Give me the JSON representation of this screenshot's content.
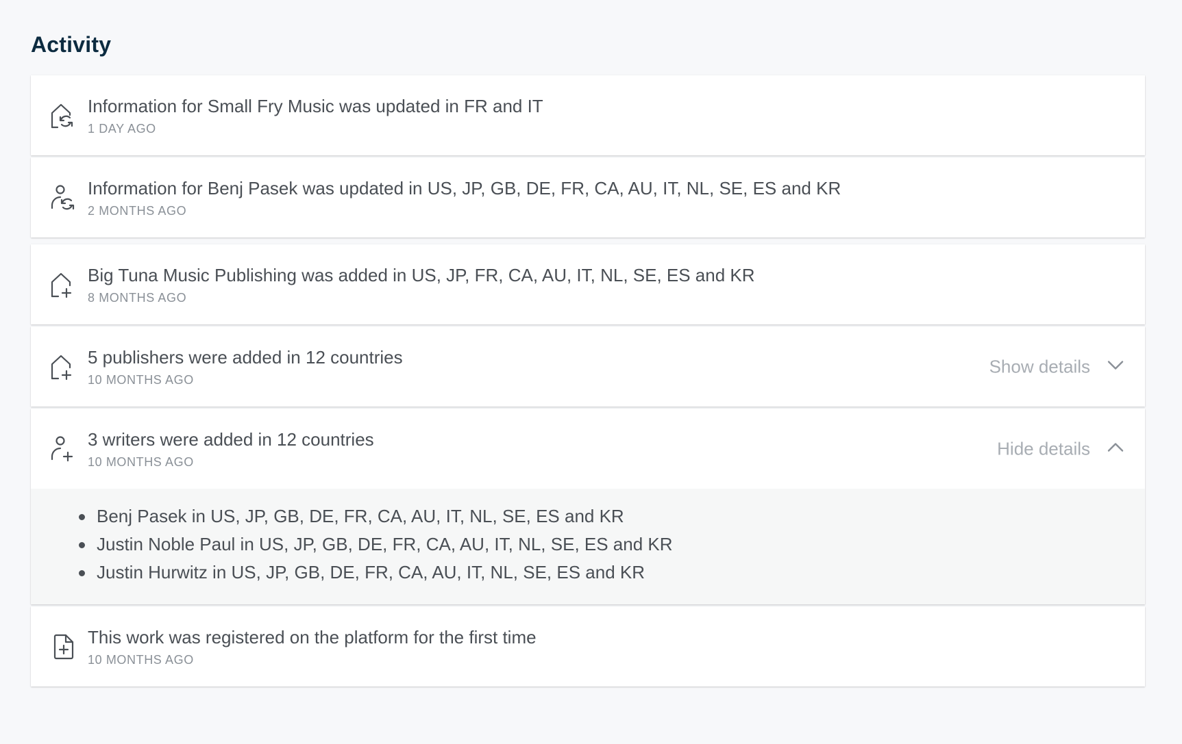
{
  "page": {
    "title": "Activity"
  },
  "activities": [
    {
      "icon": "publisher-update-icon",
      "message": "Information for Small Fry Music was updated in FR and IT",
      "time": "1 DAY AGO"
    },
    {
      "icon": "writer-update-icon",
      "message": "Information for Benj Pasek was updated in US, JP, GB, DE, FR, CA, AU, IT, NL, SE, ES and KR",
      "time": "2 MONTHS AGO"
    },
    {
      "icon": "publisher-add-icon",
      "message": "Big Tuna Music Publishing was added in US, JP, FR, CA, AU, IT, NL, SE, ES and KR",
      "time": "8 MONTHS AGO"
    },
    {
      "icon": "publisher-add-icon",
      "message": "5 publishers were added in 12 countries",
      "time": "10 MONTHS AGO",
      "toggle": "Show details"
    },
    {
      "icon": "writer-add-icon",
      "message": "3 writers were added in 12 countries",
      "time": "10 MONTHS AGO",
      "toggle": "Hide details",
      "details": [
        "Benj Pasek in US, JP, GB, DE, FR, CA, AU, IT, NL, SE, ES and KR",
        "Justin Noble Paul in US, JP, GB, DE, FR, CA, AU, IT, NL, SE, ES and KR",
        "Justin Hurwitz in US, JP, GB, DE, FR, CA, AU, IT, NL, SE, ES and KR"
      ]
    },
    {
      "icon": "document-add-icon",
      "message": "This work was registered on the platform for the first time",
      "time": "10 MONTHS AGO"
    }
  ],
  "colors": {
    "background": "#f7f8fa",
    "title": "#0c2b40",
    "text": "#4a4f55",
    "muted": "#8a9097",
    "toggle": "#a8adb3",
    "details_bg": "#f6f7f7"
  }
}
